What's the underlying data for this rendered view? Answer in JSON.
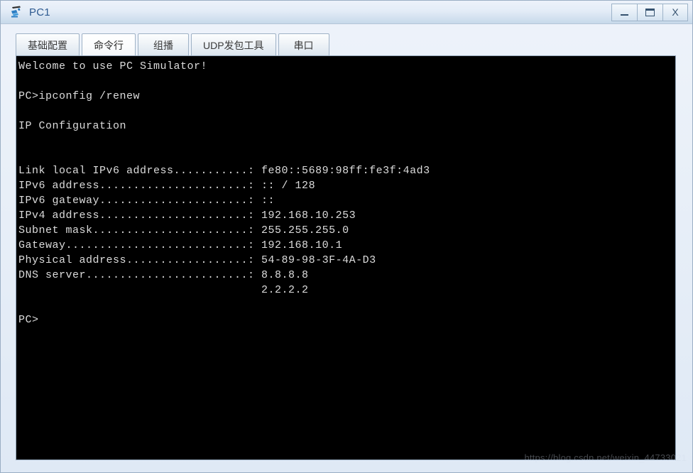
{
  "window": {
    "title": "PC1",
    "icon": "pc-network-icon",
    "controls": [
      {
        "name": "minimize-button",
        "label": "—",
        "glyph": "minimize-icon"
      },
      {
        "name": "maximize-button",
        "label": "▭",
        "glyph": "maximize-icon"
      },
      {
        "name": "close-button",
        "label": "X",
        "glyph": "close-icon"
      }
    ]
  },
  "tabs": [
    {
      "label": "基础配置",
      "active": false
    },
    {
      "label": "命令行",
      "active": true
    },
    {
      "label": "组播",
      "active": false
    },
    {
      "label": "UDP发包工具",
      "active": false
    },
    {
      "label": "串口",
      "active": false
    }
  ],
  "terminal": {
    "lines": [
      "Welcome to use PC Simulator!",
      "",
      "PC>ipconfig /renew",
      "",
      "IP Configuration",
      "",
      "",
      "Link local IPv6 address...........: fe80::5689:98ff:fe3f:4ad3",
      "IPv6 address......................: :: / 128",
      "IPv6 gateway......................: ::",
      "IPv4 address......................: 192.168.10.253",
      "Subnet mask.......................: 255.255.255.0",
      "Gateway...........................: 192.168.10.1",
      "Physical address..................: 54-89-98-3F-4A-D3",
      "DNS server........................: 8.8.8.8",
      "                                    2.2.2.2",
      "",
      "PC>"
    ],
    "command": "ipconfig /renew",
    "prompt": "PC>",
    "banner": "Welcome to use PC Simulator!",
    "section_title": "IP Configuration",
    "config": [
      {
        "label": "Link local IPv6 address",
        "value": "fe80::5689:98ff:fe3f:4ad3"
      },
      {
        "label": "IPv6 address",
        "value": ":: / 128"
      },
      {
        "label": "IPv6 gateway",
        "value": "::"
      },
      {
        "label": "IPv4 address",
        "value": "192.168.10.253"
      },
      {
        "label": "Subnet mask",
        "value": "255.255.255.0"
      },
      {
        "label": "Gateway",
        "value": "192.168.10.1"
      },
      {
        "label": "Physical address",
        "value": "54-89-98-3F-4A-D3"
      },
      {
        "label": "DNS server",
        "value": "8.8.8.8"
      },
      {
        "label": "",
        "value": "2.2.2.2"
      }
    ],
    "colors": {
      "background": "#000000",
      "text": "#dcdcdc"
    }
  },
  "watermark": {
    "text": "https://blog.csdn.net/weixin_44733021"
  }
}
